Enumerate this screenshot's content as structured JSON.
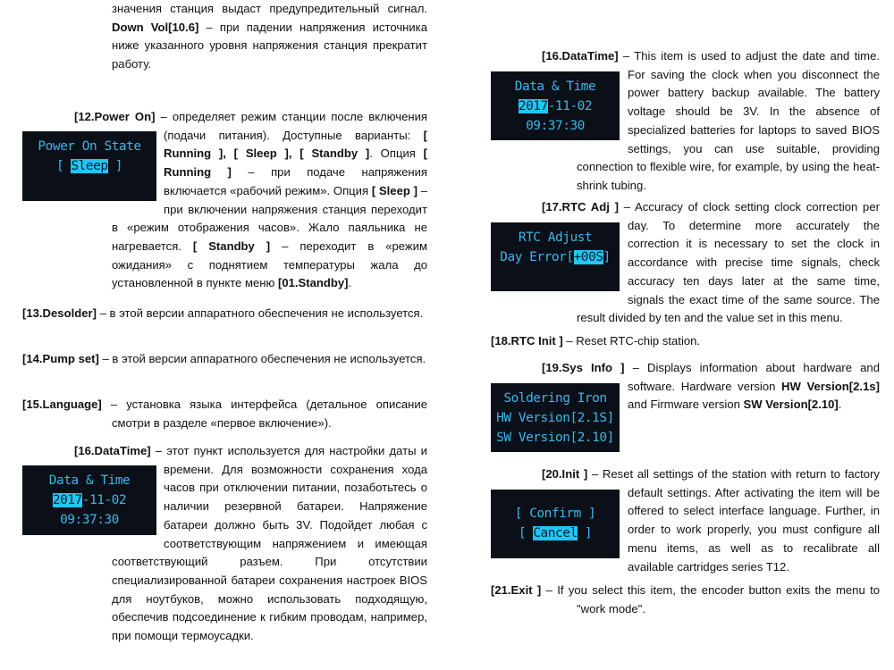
{
  "left": {
    "intro": [
      {
        "t": "значения станция выдаст предупредительный сигнал. "
      },
      {
        "t": "Down Vol[10.6]",
        "b": true
      },
      {
        "t": " – при падении напряжения источника ниже указанного уровня напряжения станция прекратит работу."
      }
    ],
    "power_on": [
      {
        "t": "[12.Power On]",
        "b": true
      },
      {
        "t": " – определяет режим станции после включения (подачи питания). Доступные варианты: "
      },
      {
        "t": "[ Running ],",
        "b": true
      },
      {
        "t": " "
      },
      {
        "t": "[ Sleep ], [ Standby ]",
        "b": true
      },
      {
        "t": ". Опция "
      },
      {
        "t": "[ Running ]",
        "b": true
      },
      {
        "t": " – при подаче напряжения включается «рабочий режим». Опция "
      },
      {
        "t": "[ Sleep ]",
        "b": true
      },
      {
        "t": " – при включении напряжения станция переходит в «режим отображения часов». Жало паяльника не нагревается. "
      },
      {
        "t": "[ Standby ]",
        "b": true
      },
      {
        "t": " – переходит в «режим ожидания» с поднятием температуры жала до установленной в пункте меню "
      },
      {
        "t": "[01.Standby]",
        "b": true
      },
      {
        "t": "."
      }
    ],
    "lcd_power": {
      "line1": "Power On State",
      "pre": "[ ",
      "sel": "Sleep",
      "post": " ]"
    },
    "desolder": [
      {
        "t": "[13.Desolder]",
        "b": true
      },
      {
        "t": " – в этой версии аппаратного обеспечения не используется."
      }
    ],
    "pump": [
      {
        "t": "[14.Pump set]",
        "b": true
      },
      {
        "t": " – в этой версии аппаратного обеспечения не используется."
      }
    ],
    "language": [
      {
        "t": "[15.Language]",
        "b": true
      },
      {
        "t": " – установка языка интерфейса (детальное описание смотри в разделе «первое включение»)."
      }
    ],
    "datatime": [
      {
        "t": "[16.DataTime]",
        "b": true
      },
      {
        "t": " – этот пункт используется для настройки даты и времени. Для возможности сохранения хода часов при отключении питании, позаботьтесь о наличии резервной батареи. Напряжение батареи должно быть 3V. Подойдет любая с соответствующим напряжением и имеющая соответствующий разъем. При отсутствии специализированной батареи сохранения настроек BIOS для ноутбуков, можно использовать подходящую, обеспечив подсоединение к гибким проводам, например, при помощи термоусадки."
      }
    ],
    "lcd_date": {
      "line1": "Data & Time",
      "sel": "2017",
      "date_rest": "-11-02",
      "time": "09:37:30"
    }
  },
  "right": {
    "datatime": [
      {
        "t": "[16.DataTime]",
        "b": true
      },
      {
        "t": " – This item is used to adjust the date and time. For saving the clock when you disconnect the power battery backup available. The battery voltage should be 3V. In the absence of specialized batteries for laptops to saved BIOS settings, you can use suitable, providing connection to flexible wire, for example, by using the heat-shrink tubing."
      }
    ],
    "lcd_date": {
      "line1": "Data & Time",
      "sel": "2017",
      "date_rest": "-11-02",
      "time": "09:37:30"
    },
    "rtc_adj": [
      {
        "t": "[17.RTC Adj ]",
        "b": true
      },
      {
        "t": " – Accuracy of clock setting clock correction per day. To determine more accurately the correction it is necessary to set the clock in accordance with precise time signals, check accuracy ten days later at the same time, signals the exact time of the same source. The result divided by ten and the value set in this menu."
      }
    ],
    "lcd_rtc": {
      "line1": "RTC Adjust",
      "pre": "Day Error[",
      "sel": "+00S",
      "post": "]"
    },
    "rtc_init": [
      {
        "t": "[18.RTC Init ]",
        "b": true
      },
      {
        "t": " – Reset RTC-chip station."
      }
    ],
    "sys_info": [
      {
        "t": "[19.Sys Info ]",
        "b": true
      },
      {
        "t": " – Displays information about hardware and software. Hardware version "
      },
      {
        "t": "HW Version[2.1s]",
        "b": true
      },
      {
        "t": " and Firmware version "
      },
      {
        "t": "SW Version[2.10]",
        "b": true
      },
      {
        "t": "."
      }
    ],
    "lcd_sys": {
      "line1": "Soldering Iron",
      "line2": "HW Version[2.1S]",
      "line3": "SW Version[2.10]"
    },
    "init": [
      {
        "t": "[20.Init ]",
        "b": true
      },
      {
        "t": " – Reset all settings of the station with return to factory default settings. After activating the item will be offered to select interface language. Further, in order to work properly, you must configure all menu items, as well as to recalibrate all available cartridges series T12."
      }
    ],
    "lcd_init": {
      "line1": "[ Confirm ]",
      "pre": "[ ",
      "sel": "Cancel",
      "post": " ]"
    },
    "exit": [
      {
        "t": "[21.Exit ]",
        "b": true
      },
      {
        "t": " – If you select this item, the encoder button exits the menu to \"work mode\"."
      }
    ]
  }
}
